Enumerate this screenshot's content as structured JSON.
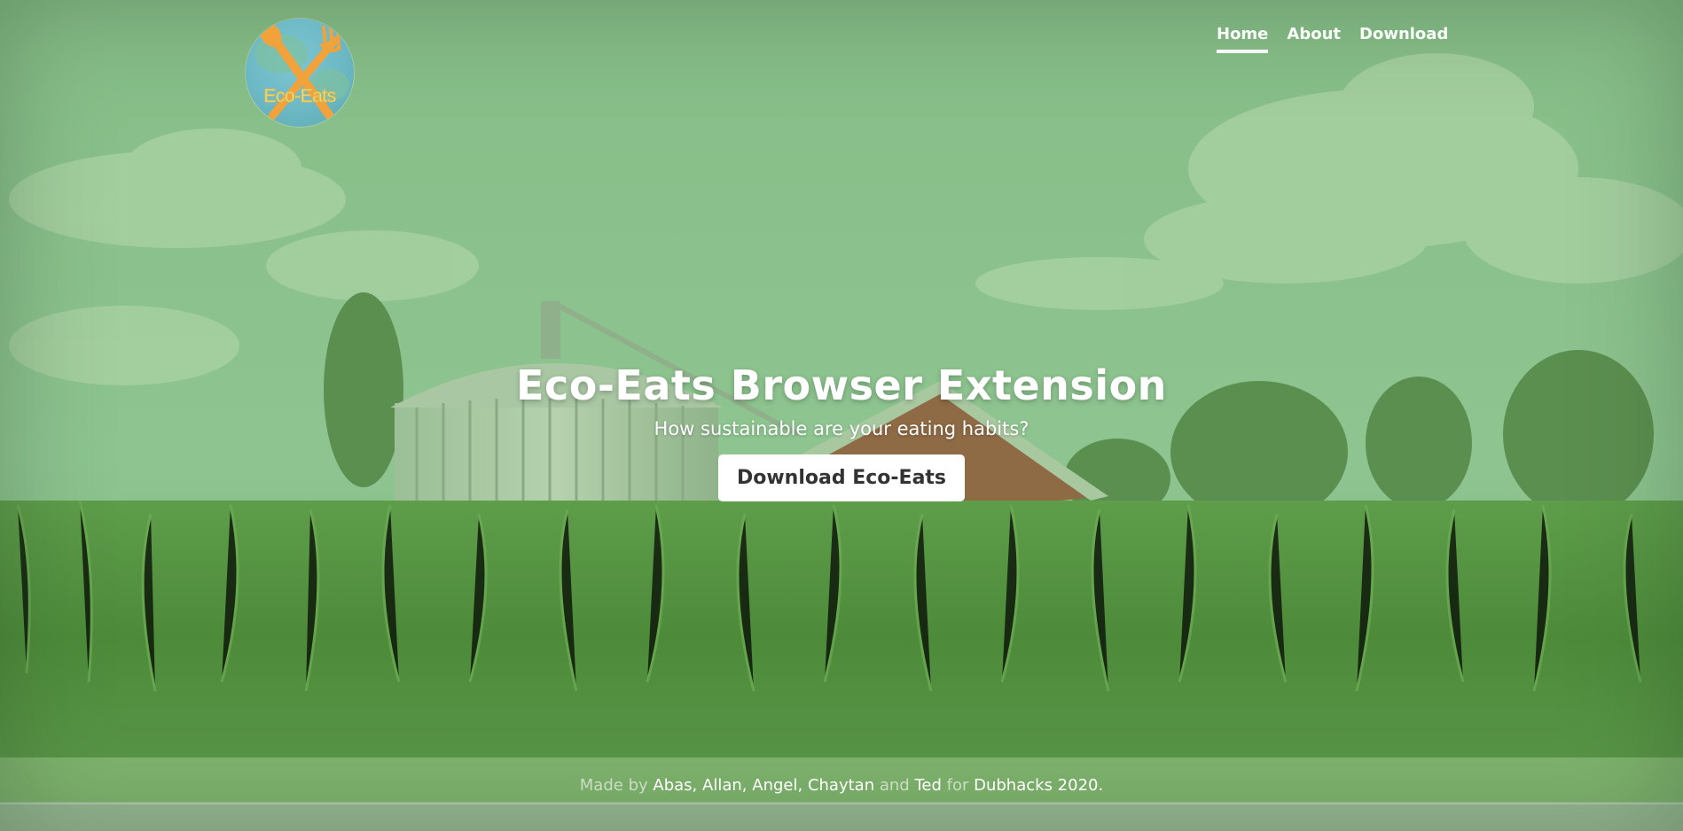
{
  "brand": {
    "logo_text": "Eco-Eats"
  },
  "nav": {
    "items": [
      {
        "label": "Home",
        "active": true
      },
      {
        "label": "About",
        "active": false
      },
      {
        "label": "Download",
        "active": false
      }
    ]
  },
  "hero": {
    "title": "Eco-Eats Browser Extension",
    "subtitle": "How sustainable are your eating habits?",
    "button_label": "Download Eco-Eats"
  },
  "footer": {
    "made_by": "Made by",
    "names": [
      "Abas",
      "Allan",
      "Angel",
      "Chaytan",
      "Ted"
    ],
    "sep": ",",
    "and": "and",
    "for": "for",
    "event": "Dubhacks 2020",
    "period": "."
  },
  "colors": {
    "overlay": "#8cc08f",
    "crop": "#4f8a3c",
    "text": "#ffffff",
    "button_bg": "#ffffff",
    "button_text": "#333333"
  },
  "icons": {
    "logo": "fork-and-spoon-icon"
  }
}
